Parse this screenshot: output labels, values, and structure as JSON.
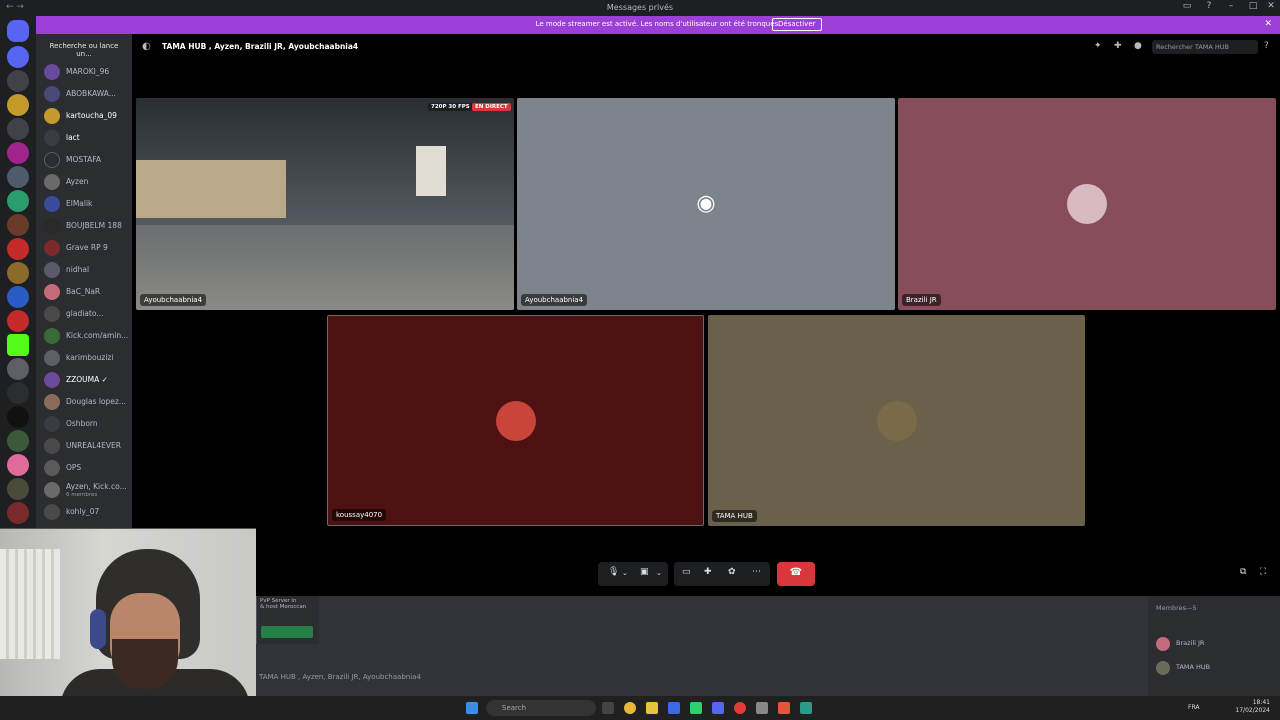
{
  "window": {
    "title": "Messages privés"
  },
  "banner": {
    "text": "Le mode streamer est activé. Les noms d'utilisateur ont été tronqués.",
    "button": "Désactiver"
  },
  "dm_list": {
    "search": "Recherche ou lance un...",
    "items": [
      {
        "name": "MAROKI_96"
      },
      {
        "name": "ABOBKAWA..."
      },
      {
        "name": "kartoucha_09"
      },
      {
        "name": "lact"
      },
      {
        "name": "MOSTAFA"
      },
      {
        "name": "Ayzen"
      },
      {
        "name": "ElMalik"
      },
      {
        "name": "BOUJBELM 188"
      },
      {
        "name": "Grave RP 9"
      },
      {
        "name": "nidhal"
      },
      {
        "name": "BaC_NaR"
      },
      {
        "name": "gladiato..."
      },
      {
        "name": "Kick.com/amin..."
      },
      {
        "name": "karimbouzizi"
      },
      {
        "name": "ZZOUMA ✓"
      },
      {
        "name": "Douglas lopez..."
      },
      {
        "name": "Oshborn"
      },
      {
        "name": "UNREAL4EVER"
      },
      {
        "name": "OPS"
      },
      {
        "name": "Ayzen, Kick.co...",
        "sub": "6 membres"
      },
      {
        "name": "kohly_07"
      }
    ]
  },
  "channel": {
    "name": "TAMA HUB , Ayzen, Brazili JR, Ayoubchaabnia4",
    "search_placeholder": "Rechercher TAMA HUB"
  },
  "tiles": [
    {
      "label": "Ayoubchaabnia4",
      "badge_quality": "720P 30 FPS",
      "badge_live": "EN DIRECT"
    },
    {
      "label": "Ayoubchaabnia4"
    },
    {
      "label": "Brazili JR"
    },
    {
      "label": "koussay4070"
    },
    {
      "label": "TAMA HUB"
    }
  ],
  "members": {
    "header": "Membres—5",
    "items": [
      {
        "name": "Brazili JR"
      },
      {
        "name": "TAMA HUB"
      }
    ]
  },
  "embed": {
    "line1": "PvP Server in",
    "line2": "& host Moroccan"
  },
  "message_bar": {
    "placeholder": "TAMA HUB , Ayzen, Brazili JR, Ayoubchaabnia4"
  },
  "taskbar": {
    "search": "Search",
    "lang": "FRA",
    "time": "18:41",
    "date": "17/02/2024"
  },
  "colors": {
    "tile_grey": "#7e848c",
    "tile_pink": "#874d5a",
    "tile_darkred": "#4d1111",
    "tile_olive": "#6b6049",
    "accent": "#5865f2",
    "danger": "#da373c"
  }
}
